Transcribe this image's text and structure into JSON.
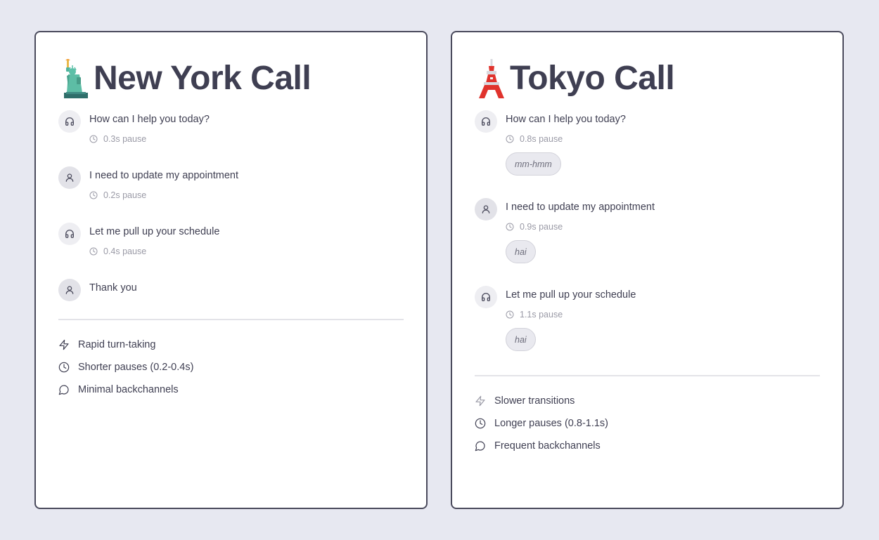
{
  "new_york": {
    "title": "New York Call",
    "flag_icon": "statue-of-liberty-emoji",
    "turns": [
      {
        "speaker": "agent",
        "message": "How can I help you today?",
        "pause": "0.3s pause"
      },
      {
        "speaker": "user",
        "message": "I need to update my appointment",
        "pause": "0.2s pause"
      },
      {
        "speaker": "agent",
        "message": "Let me pull up your schedule",
        "pause": "0.4s pause"
      },
      {
        "speaker": "user",
        "message": "Thank you"
      }
    ],
    "features": [
      {
        "icon": "lightning-icon",
        "label": "Rapid turn-taking"
      },
      {
        "icon": "clock-icon",
        "label": "Shorter pauses (0.2-0.4s)"
      },
      {
        "icon": "chat-bubble-icon",
        "label": "Minimal backchannels"
      }
    ]
  },
  "tokyo": {
    "title": "Tokyo Call",
    "flag_icon": "tokyo-tower-emoji",
    "turns": [
      {
        "speaker": "agent",
        "message": "How can I help you today?",
        "pause": "0.8s pause",
        "backchannel": "mm-hmm"
      },
      {
        "speaker": "user",
        "message": "I need to update my appointment",
        "pause": "0.9s pause",
        "backchannel": "hai"
      },
      {
        "speaker": "agent",
        "message": "Let me pull up your schedule",
        "pause": "1.1s pause",
        "backchannel": "hai"
      }
    ],
    "features": [
      {
        "icon": "lightning-icon",
        "label": "Slower transitions"
      },
      {
        "icon": "clock-icon",
        "label": "Longer pauses (0.8-1.1s)"
      },
      {
        "icon": "chat-bubble-icon",
        "label": "Frequent backchannels"
      }
    ]
  },
  "colors": {
    "background": "#e7e8f1",
    "card_border": "#4a4a5c",
    "text": "#3f3f52",
    "muted": "#9a9aa6"
  }
}
